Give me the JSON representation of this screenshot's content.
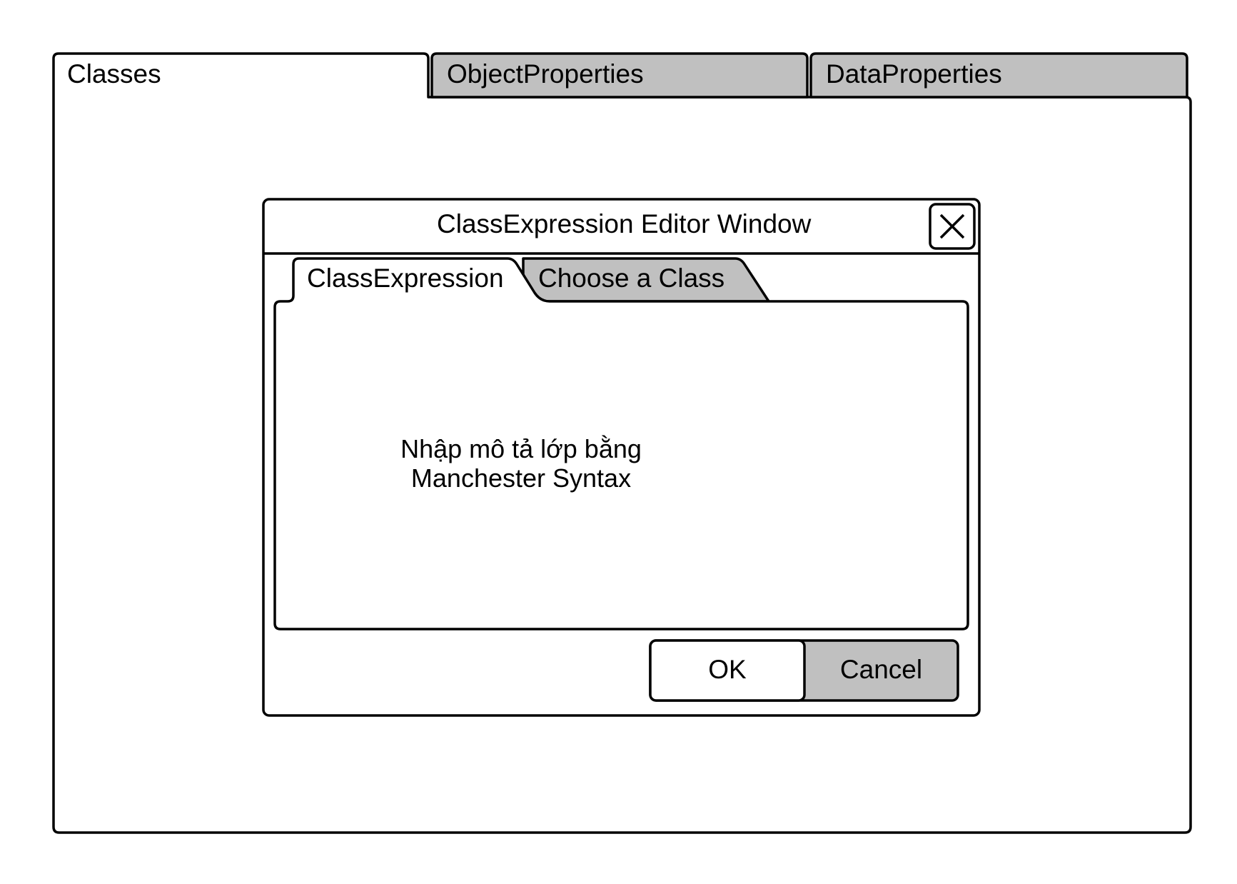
{
  "main_tabs": [
    {
      "label": "Classes",
      "active": true
    },
    {
      "label": "ObjectProperties",
      "active": false
    },
    {
      "label": "DataProperties",
      "active": false
    }
  ],
  "dialog": {
    "title": "ClassExpression Editor Window",
    "close_icon": "close-x-icon",
    "tabs": [
      {
        "label": "ClassExpression",
        "active": true
      },
      {
        "label": "Choose a Class",
        "active": false
      }
    ],
    "editor": {
      "placeholder_line1": "Nhập mô tả lớp bằng",
      "placeholder_line2": "Manchester Syntax"
    },
    "buttons": {
      "ok_label": "OK",
      "cancel_label": "Cancel"
    }
  },
  "colors": {
    "inactive_tab": "#c0c0c0",
    "border": "#000000",
    "background": "#ffffff"
  }
}
